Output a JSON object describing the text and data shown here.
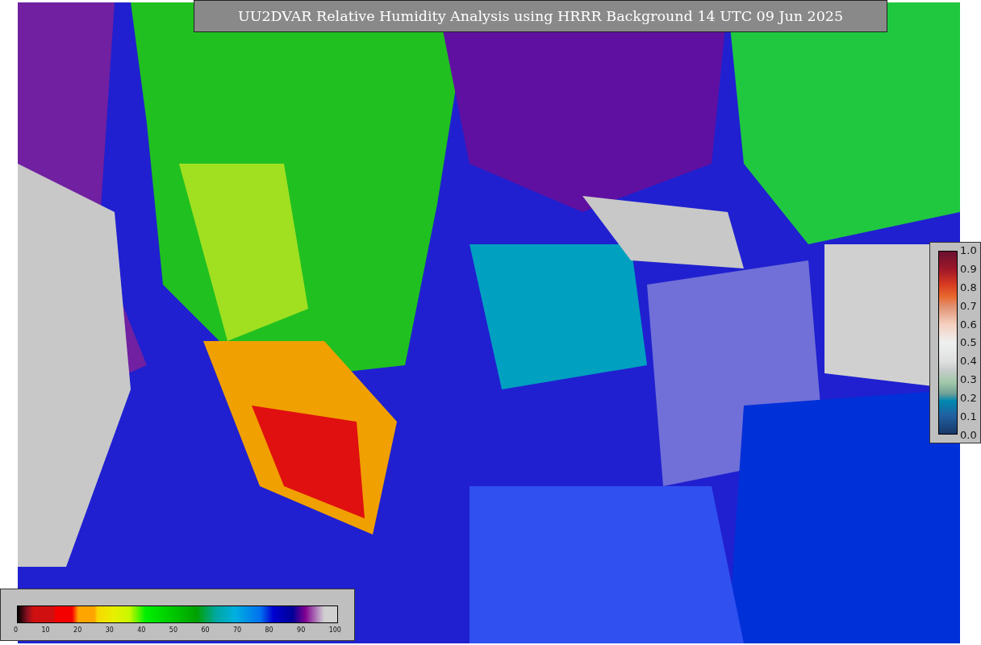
{
  "title": "UU2DVAR Relative Humidity Analysis using HRRR Background 14 UTC 09 Jun 2025",
  "horizontal_colorbar": {
    "ticks": [
      "0",
      "10",
      "20",
      "30",
      "40",
      "50",
      "60",
      "70",
      "80",
      "90",
      "100"
    ]
  },
  "vertical_colorbar": {
    "ticks": [
      "1.0",
      "0.9",
      "0.8",
      "0.7",
      "0.6",
      "0.5",
      "0.4",
      "0.3",
      "0.2",
      "0.1",
      "0.0"
    ]
  }
}
